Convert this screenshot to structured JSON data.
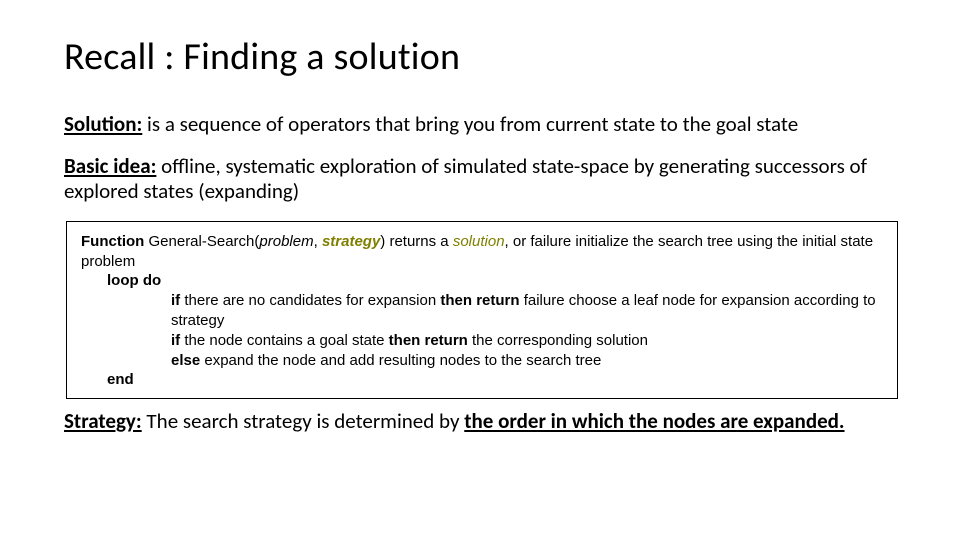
{
  "title": "Recall : Finding a solution",
  "p1": {
    "label": "Solution:",
    "text": " is a sequence of operators that bring you from current state to the goal state"
  },
  "p2": {
    "label": "Basic idea:",
    "text": " offline, systematic exploration of simulated state-space by generating successors of explored states (expanding)"
  },
  "algo": {
    "fn": "Function",
    "name": " General-Search(",
    "problem": "problem",
    "comma": ", ",
    "strategy": "strategy",
    "ret": ") returns a ",
    "solution": "solution",
    "tail1": ", or failure",
    "init": " initialize the search tree using the initial state problem",
    "loop": "loop do",
    "if1a": "if ",
    "if1b": "there are no candidates for expansion ",
    "then1": "then return ",
    "fail": "failure",
    "choose": " choose a leaf node for expansion according to strategy",
    "if2a": "if ",
    "if2b": "the node contains a goal state ",
    "then2": "then return ",
    "corr": "the corresponding solution",
    "else": "else ",
    "expand": "expand the node and add resulting nodes to the search tree",
    "end": "end"
  },
  "p3": {
    "label": "Strategy:",
    "text": " The search strategy is determined by ",
    "under": "the order in which the nodes are expanded."
  }
}
